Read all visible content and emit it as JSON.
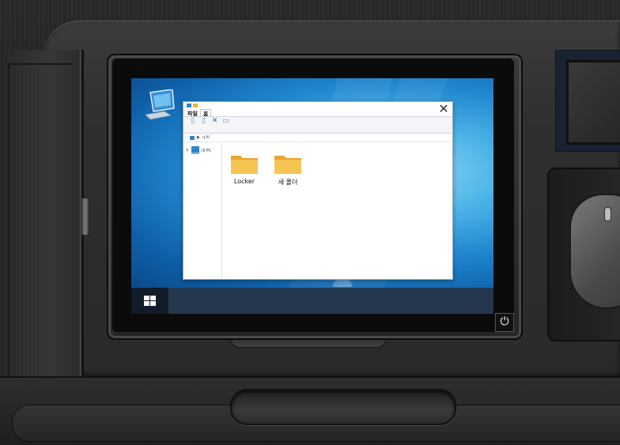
{
  "desktop": {
    "pc_icon_name": "computer-icon"
  },
  "explorer": {
    "menu": {
      "file_label": "파일",
      "home_label": "홈"
    },
    "address": {
      "path_label": "내 PC"
    },
    "nav": {
      "item_label": "내 PC"
    },
    "folders": [
      {
        "label": "Locker"
      },
      {
        "label": "새 폴더"
      }
    ]
  },
  "taskbar": {
    "start_icon": "windows-logo-icon",
    "power_icon": "power-icon"
  },
  "colors": {
    "taskbar": "#25374f",
    "start": "#111b29",
    "folder": "#f0b340",
    "wallpaper_accent": "#1f86cf"
  }
}
